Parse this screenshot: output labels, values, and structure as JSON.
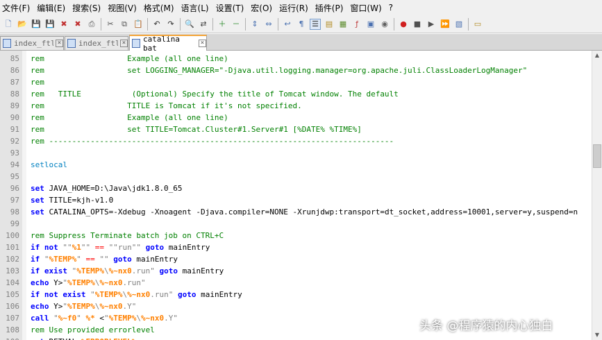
{
  "menubar": {
    "items": [
      "文件(F)",
      "编辑(E)",
      "搜索(S)",
      "视图(V)",
      "格式(M)",
      "语言(L)",
      "设置(T)",
      "宏(O)",
      "运行(R)",
      "插件(P)",
      "窗口(W)",
      "?"
    ]
  },
  "toolbar": {
    "buttons": [
      {
        "name": "new-file",
        "glyph": "🗋",
        "color": "#4a70b0"
      },
      {
        "name": "open-file",
        "glyph": "📂",
        "color": "#d7a83b"
      },
      {
        "name": "save-file",
        "glyph": "💾",
        "color": "#4a70b0"
      },
      {
        "name": "save-all",
        "glyph": "💾",
        "color": "#4a70b0"
      },
      {
        "name": "close-file",
        "glyph": "✖",
        "color": "#c03030"
      },
      {
        "name": "close-all",
        "glyph": "✖",
        "color": "#c03030"
      },
      {
        "name": "print",
        "glyph": "⎙",
        "color": "#505050"
      },
      {
        "sep": true
      },
      {
        "name": "cut",
        "glyph": "✂",
        "color": "#505050"
      },
      {
        "name": "copy",
        "glyph": "⧉",
        "color": "#505050"
      },
      {
        "name": "paste",
        "glyph": "📋",
        "color": "#8a6a3a"
      },
      {
        "sep": true
      },
      {
        "name": "undo",
        "glyph": "↶",
        "color": "#303030"
      },
      {
        "name": "redo",
        "glyph": "↷",
        "color": "#303030"
      },
      {
        "sep": true
      },
      {
        "name": "find",
        "glyph": "🔍",
        "color": "#404040"
      },
      {
        "name": "replace",
        "glyph": "⇄",
        "color": "#404040"
      },
      {
        "sep": true
      },
      {
        "name": "zoom-in",
        "glyph": "＋",
        "color": "#2a8a2a"
      },
      {
        "name": "zoom-out",
        "glyph": "－",
        "color": "#2a8a2a"
      },
      {
        "sep": true
      },
      {
        "name": "sync-vertical",
        "glyph": "⇕",
        "color": "#4a70b0"
      },
      {
        "name": "sync-horizontal",
        "glyph": "⇔",
        "color": "#4a70b0"
      },
      {
        "sep": true
      },
      {
        "name": "word-wrap",
        "glyph": "↩",
        "color": "#4a70b0"
      },
      {
        "name": "show-all-chars",
        "glyph": "¶",
        "color": "#4a70b0"
      },
      {
        "name": "indent-guide",
        "glyph": "☰",
        "color": "#303030",
        "pressed": true
      },
      {
        "name": "language-panel",
        "glyph": "▤",
        "color": "#b08a20"
      },
      {
        "name": "document-map",
        "glyph": "▦",
        "color": "#5a8a2a"
      },
      {
        "name": "function-list",
        "glyph": "ƒ",
        "color": "#c04040"
      },
      {
        "name": "folder-workspace",
        "glyph": "▣",
        "color": "#4a70b0"
      },
      {
        "name": "monitoring",
        "glyph": "◉",
        "color": "#606060"
      },
      {
        "sep": true
      },
      {
        "name": "record-macro",
        "glyph": "●",
        "color": "#d02020"
      },
      {
        "name": "stop-recording",
        "glyph": "■",
        "color": "#505050"
      },
      {
        "name": "playback-macro",
        "glyph": "▶",
        "color": "#505050"
      },
      {
        "name": "run-macro-multiple",
        "glyph": "⏩",
        "color": "#4a70b0"
      },
      {
        "name": "save-macro",
        "glyph": "▧",
        "color": "#4a70b0"
      },
      {
        "sep": true
      },
      {
        "name": "extra-tool",
        "glyph": "▭",
        "color": "#b08a20"
      }
    ]
  },
  "tabs": [
    {
      "label": "index_ftl",
      "active": false
    },
    {
      "label": "index_ftl",
      "active": false
    },
    {
      "label": "catalina bat",
      "active": true
    }
  ],
  "editor": {
    "lines": [
      {
        "n": "85",
        "tokens": [
          [
            "c",
            "rem                  Example (all one line)"
          ]
        ]
      },
      {
        "n": "86",
        "tokens": [
          [
            "c",
            "rem                  set LOGGING_MANAGER=\"-Djava.util.logging.manager=org.apache.juli.ClassLoaderLogManager\""
          ]
        ]
      },
      {
        "n": "87",
        "tokens": [
          [
            "c",
            "rem"
          ]
        ]
      },
      {
        "n": "88",
        "tokens": [
          [
            "c",
            "rem   TITLE           (Optional) Specify the title of Tomcat window. The default"
          ]
        ]
      },
      {
        "n": "89",
        "tokens": [
          [
            "c",
            "rem                  TITLE is Tomcat if it's not specified."
          ]
        ]
      },
      {
        "n": "90",
        "tokens": [
          [
            "c",
            "rem                  Example (all one line)"
          ]
        ]
      },
      {
        "n": "91",
        "tokens": [
          [
            "c",
            "rem                  set TITLE=Tomcat.Cluster#1.Server#1 [%DATE% %TIME%]"
          ]
        ]
      },
      {
        "n": "92",
        "tokens": [
          [
            "c",
            "rem ---------------------------------------------------------------------------"
          ]
        ]
      },
      {
        "n": "93",
        "tokens": []
      },
      {
        "n": "94",
        "tokens": [
          [
            "l",
            "setlocal"
          ]
        ]
      },
      {
        "n": "95",
        "tokens": []
      },
      {
        "n": "96",
        "tokens": [
          [
            "k",
            "set"
          ],
          [
            "t",
            " JAVA_HOME=D:\\Java\\jdk1.8.0_65"
          ]
        ]
      },
      {
        "n": "97",
        "tokens": [
          [
            "k",
            "set"
          ],
          [
            "t",
            " TITLE=kjh-v1.0"
          ]
        ]
      },
      {
        "n": "98",
        "tokens": [
          [
            "k",
            "set"
          ],
          [
            "t",
            " CATALINA_OPTS=-Xdebug -Xnoagent -Djava.compiler=NONE -Xrunjdwp:transport=dt_socket,address=10001,server=y,suspend=n"
          ]
        ]
      },
      {
        "n": "99",
        "tokens": []
      },
      {
        "n": "100",
        "tokens": [
          [
            "c",
            "rem Suppress Terminate batch job on CTRL+C"
          ]
        ]
      },
      {
        "n": "101",
        "tokens": [
          [
            "k",
            "if"
          ],
          [
            "t",
            " "
          ],
          [
            "k",
            "not"
          ],
          [
            "t",
            " "
          ],
          [
            "s",
            "\"\""
          ],
          [
            "v",
            "%1"
          ],
          [
            "s",
            "\"\""
          ],
          [
            "t",
            " "
          ],
          [
            "o",
            "=="
          ],
          [
            "t",
            " "
          ],
          [
            "s",
            "\"\"run\"\""
          ],
          [
            "t",
            " "
          ],
          [
            "k",
            "goto"
          ],
          [
            "t",
            " mainEntry"
          ]
        ]
      },
      {
        "n": "102",
        "tokens": [
          [
            "k",
            "if"
          ],
          [
            "t",
            " "
          ],
          [
            "s",
            "\""
          ],
          [
            "v",
            "%TEMP%"
          ],
          [
            "s",
            "\""
          ],
          [
            "t",
            " "
          ],
          [
            "o",
            "=="
          ],
          [
            "t",
            " "
          ],
          [
            "s",
            "\"\""
          ],
          [
            "t",
            " "
          ],
          [
            "k",
            "goto"
          ],
          [
            "t",
            " mainEntry"
          ]
        ]
      },
      {
        "n": "103",
        "tokens": [
          [
            "k",
            "if"
          ],
          [
            "t",
            " "
          ],
          [
            "k",
            "exist"
          ],
          [
            "t",
            " "
          ],
          [
            "s",
            "\""
          ],
          [
            "v",
            "%TEMP%"
          ],
          [
            "s",
            "\\"
          ],
          [
            "v",
            "%~nx0"
          ],
          [
            "s",
            ".run\""
          ],
          [
            "t",
            " "
          ],
          [
            "k",
            "goto"
          ],
          [
            "t",
            " mainEntry"
          ]
        ]
      },
      {
        "n": "104",
        "tokens": [
          [
            "k",
            "echo"
          ],
          [
            "t",
            " Y>"
          ],
          [
            "s",
            "\""
          ],
          [
            "v",
            "%TEMP%"
          ],
          [
            "s",
            "\\"
          ],
          [
            "v",
            "%~nx0"
          ],
          [
            "s",
            ".run\""
          ]
        ]
      },
      {
        "n": "105",
        "tokens": [
          [
            "k",
            "if"
          ],
          [
            "t",
            " "
          ],
          [
            "k",
            "not"
          ],
          [
            "t",
            " "
          ],
          [
            "k",
            "exist"
          ],
          [
            "t",
            " "
          ],
          [
            "s",
            "\""
          ],
          [
            "v",
            "%TEMP%"
          ],
          [
            "s",
            "\\"
          ],
          [
            "v",
            "%~nx0"
          ],
          [
            "s",
            ".run\""
          ],
          [
            "t",
            " "
          ],
          [
            "k",
            "goto"
          ],
          [
            "t",
            " mainEntry"
          ]
        ]
      },
      {
        "n": "106",
        "tokens": [
          [
            "k",
            "echo"
          ],
          [
            "t",
            " Y>"
          ],
          [
            "s",
            "\""
          ],
          [
            "v",
            "%TEMP%"
          ],
          [
            "s",
            "\\"
          ],
          [
            "v",
            "%~nx0"
          ],
          [
            "s",
            ".Y\""
          ]
        ]
      },
      {
        "n": "107",
        "tokens": [
          [
            "k",
            "call"
          ],
          [
            "t",
            " "
          ],
          [
            "s",
            "\""
          ],
          [
            "v",
            "%~f0"
          ],
          [
            "s",
            "\""
          ],
          [
            "t",
            " "
          ],
          [
            "v",
            "%*"
          ],
          [
            "t",
            " <"
          ],
          [
            "s",
            "\""
          ],
          [
            "v",
            "%TEMP%"
          ],
          [
            "s",
            "\\"
          ],
          [
            "v",
            "%~nx0"
          ],
          [
            "s",
            ".Y\""
          ]
        ]
      },
      {
        "n": "108",
        "tokens": [
          [
            "c",
            "rem Use provided errorlevel"
          ]
        ]
      },
      {
        "n": "109",
        "tokens": [
          [
            "k",
            "set"
          ],
          [
            "t",
            " RETVAL="
          ],
          [
            "v",
            "%ERRORLEVEL%"
          ]
        ]
      }
    ]
  },
  "watermark": "头条 @程序猿的内心独白"
}
